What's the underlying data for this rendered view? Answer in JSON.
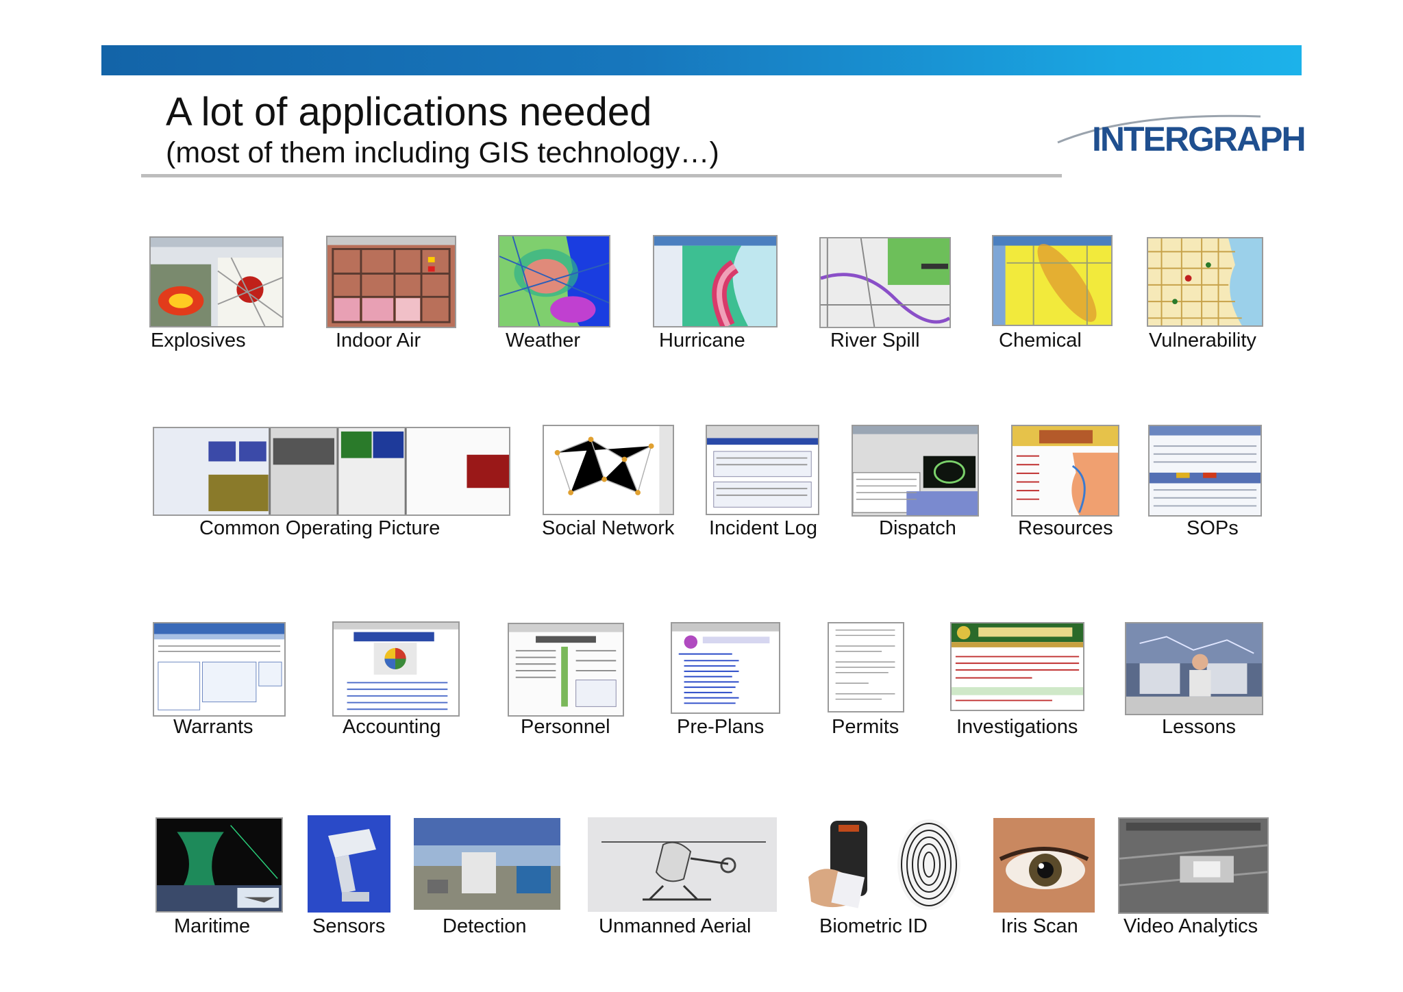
{
  "slide": {
    "title": "A lot of applications needed",
    "subtitle": "(most of them including GIS technology…)",
    "logo_text": "INTERGRAPH",
    "accent_color": "#1777bd"
  },
  "rows": [
    [
      "Explosives",
      "Indoor Air",
      "Weather",
      "Hurricane",
      "River Spill",
      "Chemical",
      "Vulnerability"
    ],
    [
      "Common Operating Picture",
      "Social Network",
      "Incident Log",
      "Dispatch",
      "Resources",
      "SOPs"
    ],
    [
      "Warrants",
      "Accounting",
      "Personnel",
      "Pre-Plans",
      "Permits",
      "Investigations",
      "Lessons"
    ],
    [
      "Maritime",
      "Sensors",
      "Detection",
      "Unmanned Aerial",
      "Biometric ID",
      "Iris Scan",
      "Video Analytics"
    ]
  ],
  "thumbnail_images": {
    "explosives": "map-thumbnail",
    "indoor_air": "floor-plan-thumbnail",
    "weather": "weather-map-thumbnail",
    "hurricane": "hurricane-map-thumbnail",
    "river_spill": "river-map-thumbnail",
    "chemical": "plume-map-thumbnail",
    "vulnerability": "city-map-thumbnail",
    "maritime": "radar-screen-photo",
    "sensors": "camera-sensor-photo",
    "detection": "checkpoint-photo",
    "unmanned_aerial": "helicopter-drone-photo",
    "biometric_id": "fingerprint-scanner-photo",
    "iris_scan": "eye-photo",
    "video_analytics": "surveillance-frame-photo"
  }
}
